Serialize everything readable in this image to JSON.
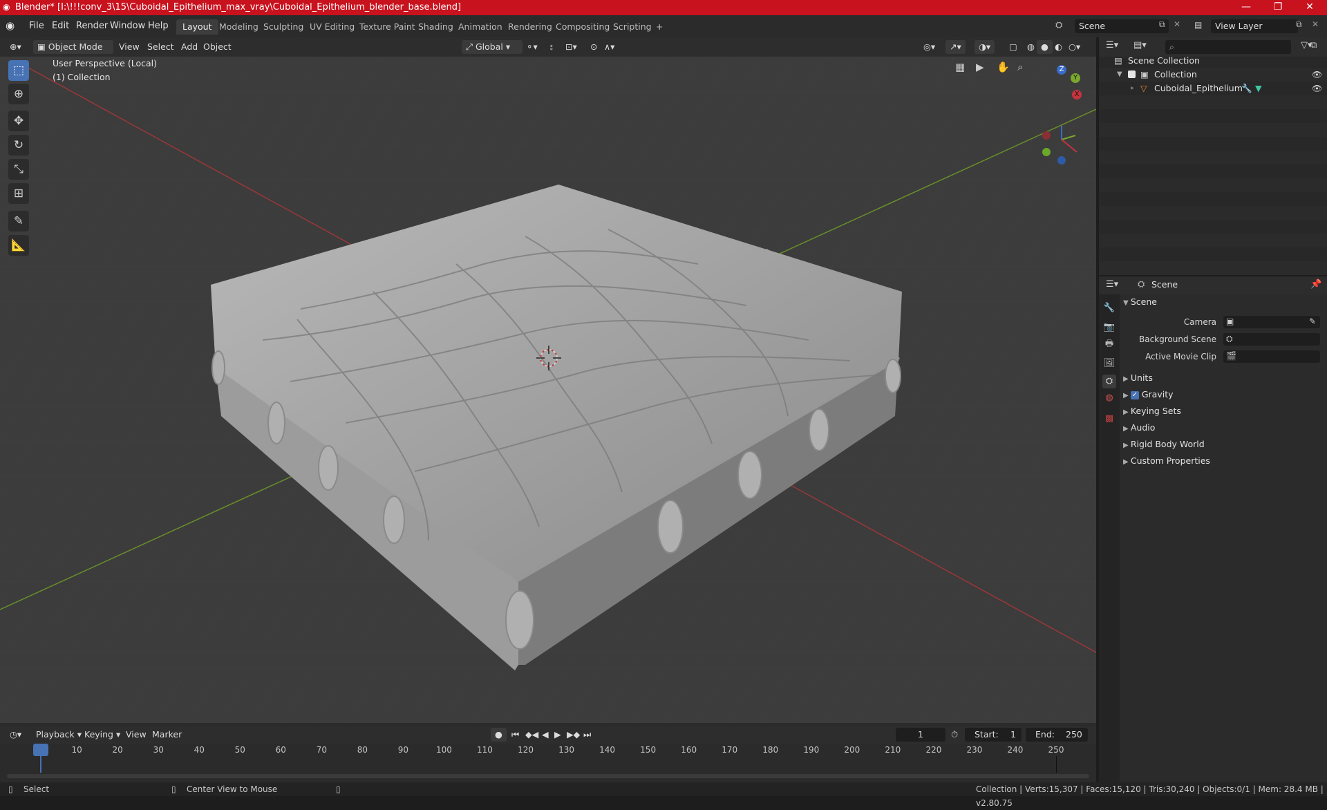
{
  "window": {
    "title": "Blender* [I:\\!!!conv_3\\15\\Cuboidal_Epithelium_max_vray\\Cuboidal_Epithelium_blender_base.blend]",
    "minimize": "—",
    "maximize": "❐",
    "close": "✕"
  },
  "menu": [
    "File",
    "Edit",
    "Render",
    "Window",
    "Help"
  ],
  "workspaces": [
    "Layout",
    "Modeling",
    "Sculpting",
    "UV Editing",
    "Texture Paint",
    "Shading",
    "Animation",
    "Rendering",
    "Compositing",
    "Scripting"
  ],
  "workspace_add": "+",
  "scene_field": "Scene",
  "view_layer_field": "View Layer",
  "viewport_header": {
    "mode": "Object Mode",
    "view": "View",
    "select": "Select",
    "add": "Add",
    "object": "Object",
    "transform_orientation": "Global"
  },
  "viewport": {
    "perspective_label": "User Perspective (Local)",
    "collection_label": "(1) Collection",
    "gizmo": {
      "x": "X",
      "y": "Y",
      "z": "Z"
    }
  },
  "outliner": {
    "search_placeholder": "",
    "scene_collection": "Scene Collection",
    "collection": "Collection",
    "object": "Cuboidal_Epithelium"
  },
  "properties": {
    "breadcrumb": "Scene",
    "section_scene": "Scene",
    "camera_label": "Camera",
    "background_scene_label": "Background Scene",
    "active_movie_clip_label": "Active Movie Clip",
    "sections": [
      "Units",
      "Gravity",
      "Keying Sets",
      "Audio",
      "Rigid Body World",
      "Custom Properties"
    ],
    "gravity_checked": true
  },
  "timeline": {
    "playback": "Playback",
    "keying": "Keying",
    "view": "View",
    "marker": "Marker",
    "current_frame": "1",
    "start_label": "Start:",
    "start_value": "1",
    "end_label": "End:",
    "end_value": "250",
    "ticks": [
      "1",
      "10",
      "20",
      "30",
      "40",
      "50",
      "60",
      "70",
      "80",
      "90",
      "100",
      "110",
      "120",
      "130",
      "140",
      "150",
      "160",
      "170",
      "180",
      "190",
      "200",
      "210",
      "220",
      "230",
      "240",
      "250"
    ]
  },
  "statusbar": {
    "select": "Select",
    "center_view": "Center View to Mouse",
    "stats": "Collection | Verts:15,307 | Faces:15,120 | Tris:30,240 | Objects:0/1 | Mem: 28.4 MB | v2.80.75"
  },
  "colors": {
    "titlebar": "#c8121e",
    "active_tool": "#4772b3",
    "viewport_bg": "#3d3d3d",
    "x_axis": "#b53a3a",
    "y_axis": "#6c9a2a"
  }
}
